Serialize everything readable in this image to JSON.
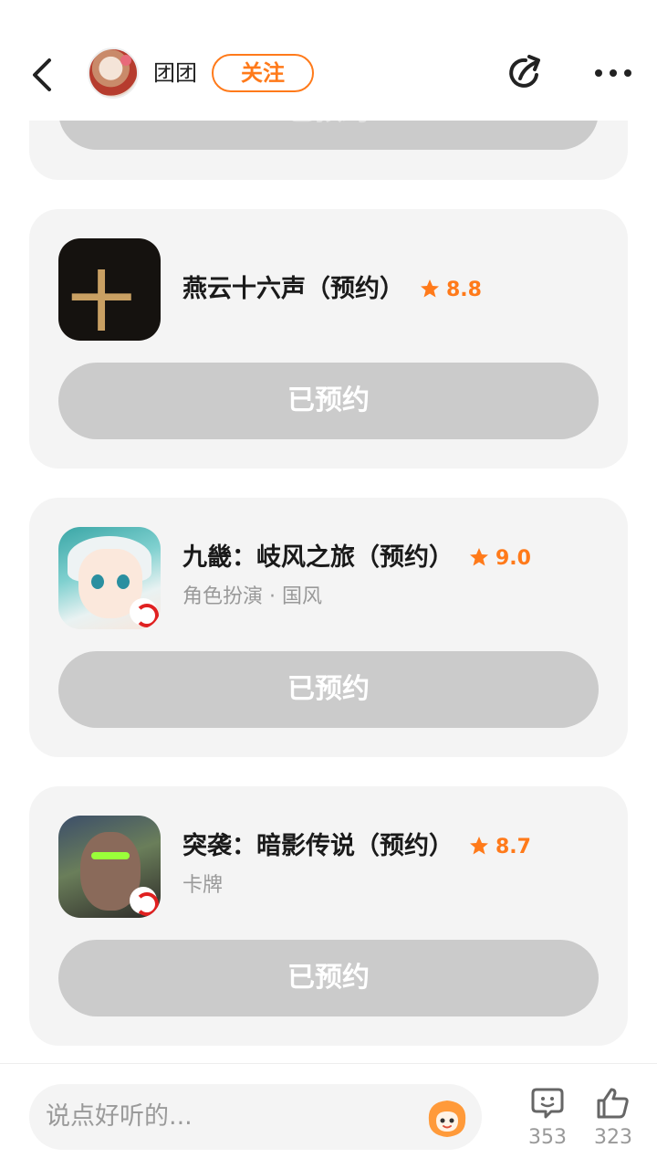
{
  "header": {
    "username": "团团",
    "follow_label": "关注",
    "icons": [
      "back-icon",
      "share-icon",
      "more-icon"
    ]
  },
  "top_card": {
    "button_label": "已预约"
  },
  "games": [
    {
      "title": "燕云十六声（预约）",
      "rating": "8.8",
      "tags": "",
      "button_label": "已预约",
      "icon_text": "十"
    },
    {
      "title": "九畿：岐风之旅（预约）",
      "rating": "9.0",
      "tags": "角色扮演 · 国风",
      "button_label": "已预约"
    },
    {
      "title": "突袭：暗影传说（预约）",
      "rating": "8.7",
      "tags": "卡牌",
      "button_label": "已预约"
    }
  ],
  "bottom_bar": {
    "comment_placeholder": "说点好听的...",
    "comment_count": "353",
    "like_count": "323"
  },
  "colors": {
    "accent": "#ff7a1a",
    "button_disabled": "#cbcbcb",
    "card_bg": "#f4f4f4"
  }
}
